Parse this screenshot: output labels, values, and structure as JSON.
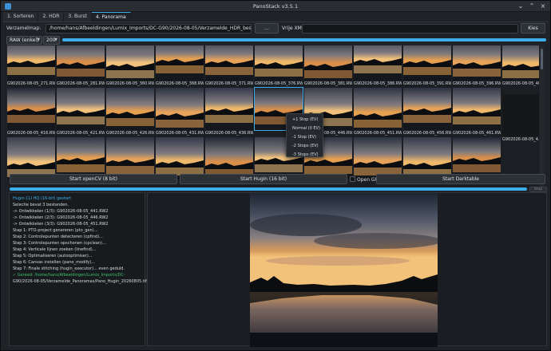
{
  "window": {
    "title": "PanoStack v3.5.1",
    "controls": [
      "minimize",
      "maximize",
      "close"
    ]
  },
  "tabs": [
    {
      "label": "1. Sorteren",
      "active": false
    },
    {
      "label": "2. HDR",
      "active": false
    },
    {
      "label": "3. Burst",
      "active": false
    },
    {
      "label": "4. Panorama",
      "active": true
    }
  ],
  "folder_row": {
    "label": "Verzamelmap:",
    "path": "/home/hans/Afbeeldingen/Lumix_Imports/DC-G90/2026-08-05/Verzamelde_HDR_bestanden",
    "browse_label": "...",
    "xmp_label": "Vrije XMP:",
    "xmp_value": "",
    "choose_label": "Kies"
  },
  "filter_row": {
    "type_value": "RAW (enkel)",
    "size_value": "200"
  },
  "thumbnails": {
    "row1": [
      "G902026-08-05_271.RW2",
      "G902026-08-05_281.RW2",
      "G902026-08-05_360.RW2",
      "G902026-08-05_368.RW2",
      "G902026-08-05_371.RW2",
      "G902026-08-05_376.RW2",
      "G902026-08-05_381.RW2",
      "G902026-08-05_386.RW2",
      "G902026-08-05_391.RW2",
      "G902026-08-05_396.RW2",
      "G902026-08-05_401..."
    ],
    "row2": [
      "G902026-08-05_416.RW2",
      "G902026-08-05_421.RW2",
      "G902026-08-05_426.RW2",
      "G902026-08-05_431.RW2",
      "G902026-08-05_436.RW2",
      "",
      "G902026-08-05_446.RW2",
      "G902026-08-05_451.RW2",
      "G902026-08-05_456.RW2",
      "G902026-08-05_461.RW2"
    ],
    "side_caption": "G902026-08-05_4...",
    "selected_index_row2": 5
  },
  "context_menu": {
    "items": [
      "+1 Stop (EV)",
      "Normal (0 EV)",
      "-1 Stop (EV)",
      "-2 Stops (EV)",
      "-3 Stops (EV)"
    ]
  },
  "actions": {
    "opencv_label": "Start openCV (8 bit)",
    "hugin_label": "Start Hugin (16 bit)",
    "open_gui_label": "Open GUI",
    "open_gui_checked": false,
    "darktable_label": "Start Darktable",
    "stop_label": "Stop"
  },
  "progress": {
    "top_fraction": 1.0,
    "main_fraction": 1.0
  },
  "log": {
    "lines": [
      {
        "text": "Hugin CLI HQ (16-bit) gestart",
        "kind": "head"
      },
      {
        "text": "Selectie bevat 3 bestanden.",
        "kind": "normal"
      },
      {
        "text": "  -> Ontwikkelen (1/3): G902026-08-05_441.RW2",
        "kind": "normal"
      },
      {
        "text": "  -> Ontwikkelen (2/3): G902026-08-05_446.RW2",
        "kind": "normal"
      },
      {
        "text": "  -> Ontwikkelen (3/3): G902026-08-05_451.RW2",
        "kind": "normal"
      },
      {
        "text": "Stap 1: PTO-project genereren (pto_gen)...",
        "kind": "normal"
      },
      {
        "text": "Stap 2: Controlepunten detecteren (cpfind)...",
        "kind": "normal"
      },
      {
        "text": "Stap 3: Controlepunten opschonen (cpclean)...",
        "kind": "normal"
      },
      {
        "text": "Stap 4: Verticale lijnen zoeken (linefind)...",
        "kind": "normal"
      },
      {
        "text": "Stap 5: Optimaliseren (autooptimiser)...",
        "kind": "normal"
      },
      {
        "text": "Stap 6: Canvas instellen (pano_modify)...",
        "kind": "normal"
      },
      {
        "text": "Stap 7: Finale stitching (hugin_executor)... even geduld.",
        "kind": "normal"
      },
      {
        "text": "✓ Gereed: /home/hans/Afbeeldingen/Lumix_Imports/DC-",
        "kind": "ok"
      },
      {
        "text": "G90/2026-08-05/Verzamelde_Panoramas/Pano_Hugin_20260805.tif",
        "kind": "normal"
      }
    ]
  },
  "colors": {
    "accent": "#3daee9",
    "success": "#3fbf6a",
    "background": "#1f2327"
  }
}
